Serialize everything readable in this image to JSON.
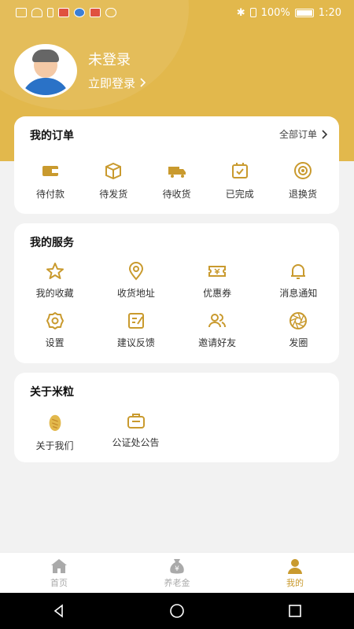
{
  "status_bar": {
    "battery_text": "100%",
    "time": "1:20"
  },
  "colors": {
    "accent": "#e2b84c",
    "icon": "#c99a2e",
    "inactive": "#aaaaaa"
  },
  "profile": {
    "title": "未登录",
    "login_link": "立即登录",
    "avatar_icon": "user-avatar"
  },
  "orders": {
    "title": "我的订单",
    "all_label": "全部订单",
    "items": [
      {
        "label": "待付款",
        "icon": "wallet-icon"
      },
      {
        "label": "待发货",
        "icon": "box-icon"
      },
      {
        "label": "待收货",
        "icon": "truck-icon"
      },
      {
        "label": "已完成",
        "icon": "check-bag-icon"
      },
      {
        "label": "退换货",
        "icon": "return-icon"
      }
    ]
  },
  "services": {
    "title": "我的服务",
    "items": [
      {
        "label": "我的收藏",
        "icon": "star-icon"
      },
      {
        "label": "收货地址",
        "icon": "location-icon"
      },
      {
        "label": "优惠券",
        "icon": "coupon-icon"
      },
      {
        "label": "消息通知",
        "icon": "bell-icon"
      },
      {
        "label": "设置",
        "icon": "gear-icon"
      },
      {
        "label": "建议反馈",
        "icon": "feedback-icon"
      },
      {
        "label": "邀请好友",
        "icon": "friends-icon"
      },
      {
        "label": "发圈",
        "icon": "aperture-icon"
      }
    ]
  },
  "about": {
    "title": "关于米粒",
    "items": [
      {
        "label": "关于我们",
        "icon": "rice-grain-icon"
      },
      {
        "label": "公证处公告",
        "icon": "notice-icon"
      }
    ]
  },
  "tabbar": {
    "items": [
      {
        "label": "首页",
        "icon": "home-icon",
        "active": false
      },
      {
        "label": "养老金",
        "icon": "money-bag-icon",
        "active": false
      },
      {
        "label": "我的",
        "icon": "person-icon",
        "active": true
      }
    ]
  }
}
